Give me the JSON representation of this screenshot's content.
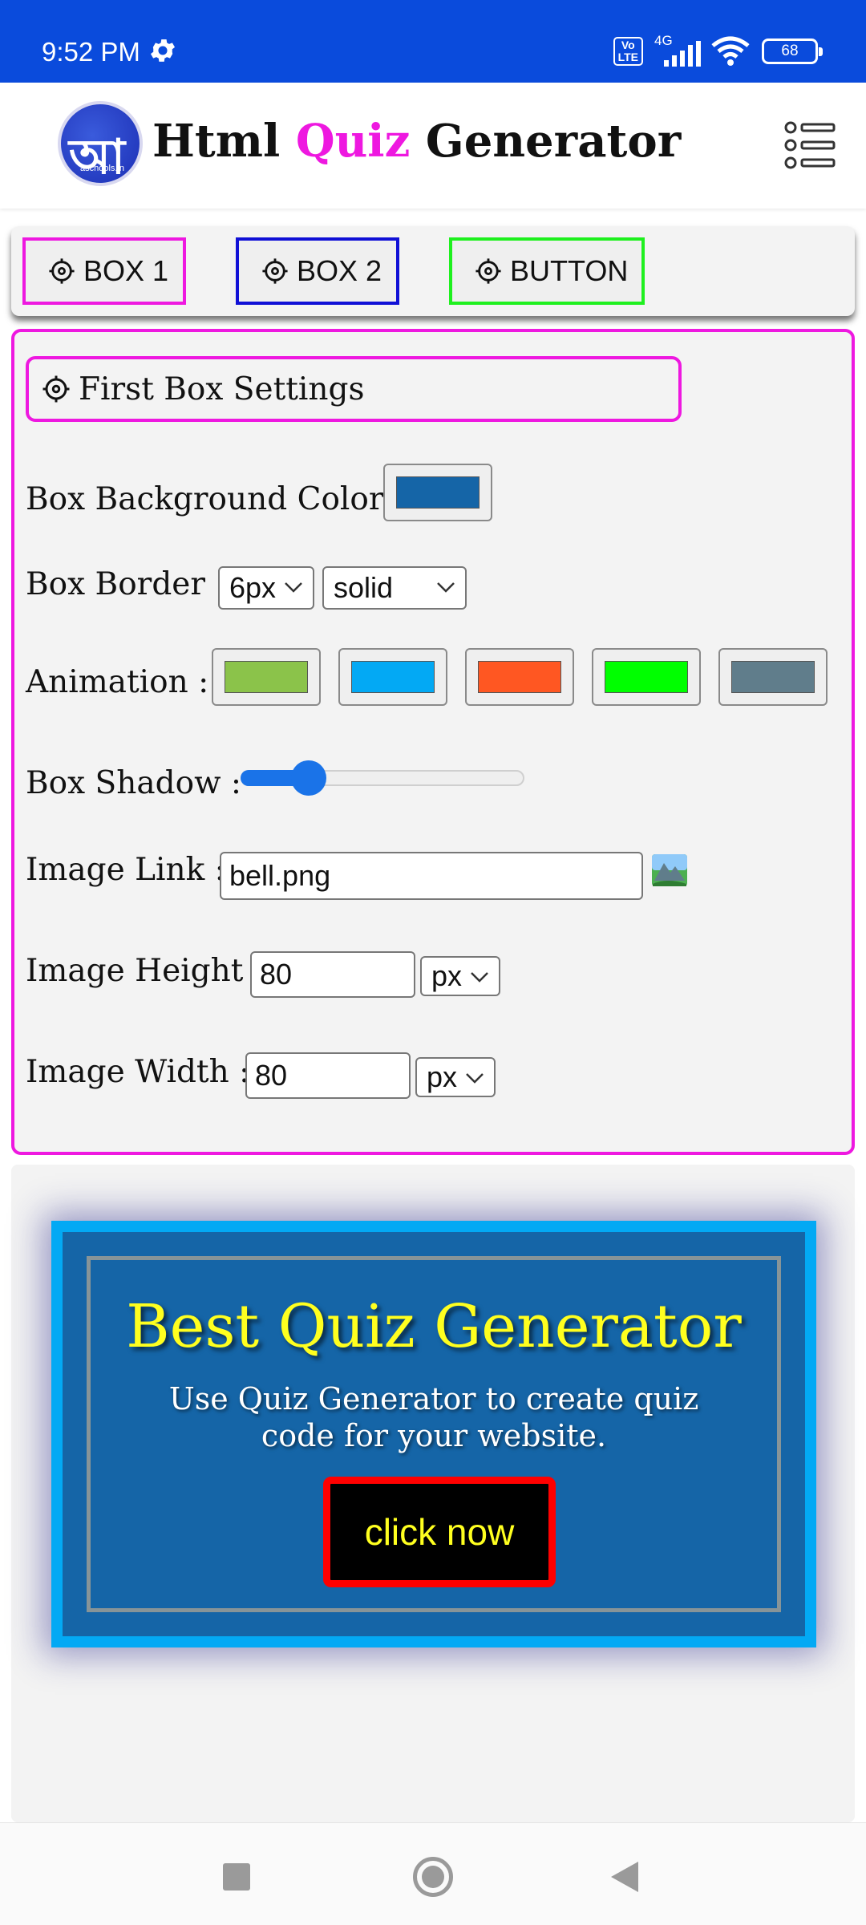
{
  "status_bar": {
    "time": "9:52 PM",
    "volte": "Vo\nLTE",
    "network": "4G",
    "battery": "68"
  },
  "header": {
    "logo_glyph": "আ",
    "logo_caption": "aschools.in",
    "title_part1": "Html ",
    "title_accent": "Quiz",
    "title_part2": " Generator",
    "accent_color": "#ee18e0"
  },
  "tabs": [
    {
      "label": "BOX 1",
      "border_color": "#ee18e0"
    },
    {
      "label": "BOX 2",
      "border_color": "#1010d6"
    },
    {
      "label": "BUTTON",
      "border_color": "#1ef01e"
    }
  ],
  "settings": {
    "title": "First Box Settings",
    "bg_color_label": "Box Background Color :",
    "bg_color_value": "#1565a7",
    "border_label": "Box Border :",
    "border_width": "6px",
    "border_style": "solid",
    "animation_label": "Animation :",
    "animation_swatches": [
      "#8bc34a",
      "#03a9f4",
      "#ff5722",
      "#00ff00",
      "#607d8b"
    ],
    "shadow_label": "Box Shadow :",
    "shadow_value": 0.24,
    "image_link_label": "Image Link :",
    "image_link_value": "bell.png",
    "image_height_label": "Image Height :",
    "image_height_value": "80",
    "image_height_unit": "px",
    "image_width_label": "Image Width :",
    "image_width_value": "80",
    "image_width_unit": "px"
  },
  "preview": {
    "heading": "Best Quiz Generator",
    "text": "Use Quiz Generator to create quiz code for your website.",
    "button_label": "click now",
    "heading_color": "#ffff1f",
    "button_border_color": "#ff0000"
  }
}
